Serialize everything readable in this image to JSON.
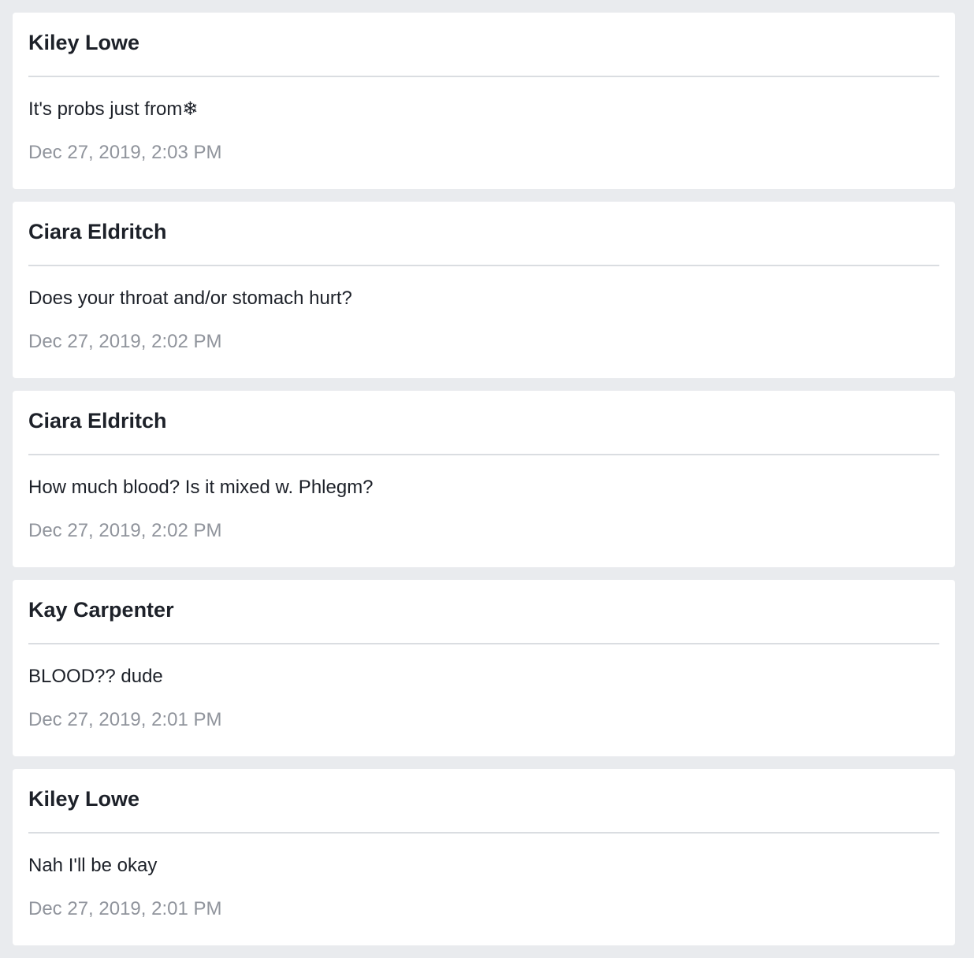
{
  "messages": [
    {
      "sender": "Kiley Lowe",
      "text": "It's probs just from❄",
      "timestamp": "Dec 27, 2019, 2:03 PM"
    },
    {
      "sender": "Ciara Eldritch",
      "text": "Does your throat and/or stomach hurt?",
      "timestamp": "Dec 27, 2019, 2:02 PM"
    },
    {
      "sender": "Ciara Eldritch",
      "text": "How much blood? Is it mixed w. Phlegm?",
      "timestamp": "Dec 27, 2019, 2:02 PM"
    },
    {
      "sender": "Kay Carpenter",
      "text": "BLOOD?? dude",
      "timestamp": "Dec 27, 2019, 2:01 PM"
    },
    {
      "sender": "Kiley Lowe",
      "text": "Nah I'll be okay",
      "timestamp": "Dec 27, 2019, 2:01 PM"
    }
  ]
}
